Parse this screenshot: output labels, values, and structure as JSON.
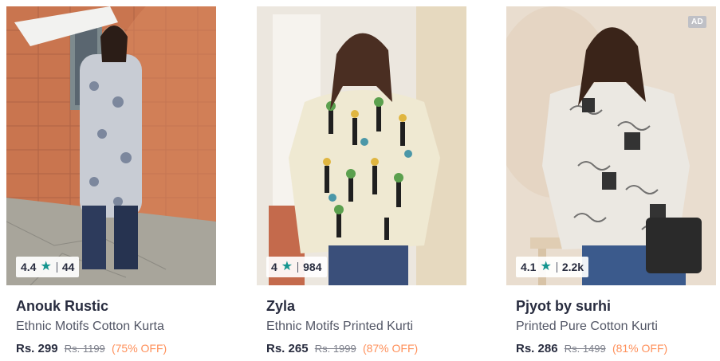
{
  "products": [
    {
      "rating": "4.4",
      "rating_count": "44",
      "brand": "Anouk Rustic",
      "title": "Ethnic Motifs Cotton Kurta",
      "price": "Rs. 299",
      "mrp": "Rs. 1199",
      "discount": "(75% OFF)",
      "ad_label": ""
    },
    {
      "rating": "4",
      "rating_count": "984",
      "brand": "Zyla",
      "title": "Ethnic Motifs Printed Kurti",
      "price": "Rs. 265",
      "mrp": "Rs. 1999",
      "discount": "(87% OFF)",
      "ad_label": ""
    },
    {
      "rating": "4.1",
      "rating_count": "2.2k",
      "brand": "Pjyot by surhi",
      "title": "Printed Pure Cotton Kurti",
      "price": "Rs. 286",
      "mrp": "Rs. 1499",
      "discount": "(81% OFF)",
      "ad_label": "AD"
    }
  ],
  "icons": {
    "rating_star": "star-icon"
  },
  "colors": {
    "star": "#14958f",
    "discount": "#ff905a",
    "brand_text": "#282c3f",
    "muted_text": "#535766"
  }
}
